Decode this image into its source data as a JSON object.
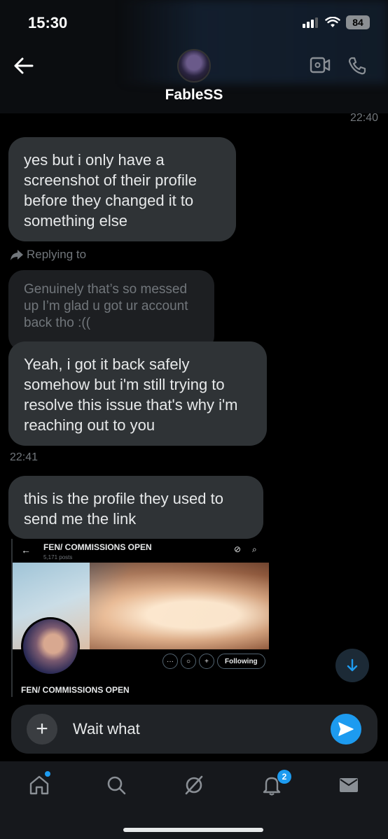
{
  "status": {
    "time": "15:30",
    "battery": "84"
  },
  "header": {
    "title": "FableSS",
    "last_time": "22:40"
  },
  "messages": [
    {
      "text": "yes but i only have a screenshot of their profile before they changed it to something else"
    },
    {
      "reply_label": "Replying to",
      "quoted": "Genuinely that’s so messed up I’m glad u got ur account back tho :((",
      "text": "Yeah, i got it back safely somehow but i'm still trying to resolve this issue that's why i'm reaching out to you",
      "time": "22:41"
    },
    {
      "text": "this is the profile they used to send me the link"
    }
  ],
  "screenshot": {
    "name": "FEN/ COMMISSIONS OPEN",
    "posts": "5,171 posts",
    "follow_label": "Following",
    "name_below": "FEN/ COMMISSIONS OPEN"
  },
  "composer": {
    "value": "Wait what"
  },
  "nav": {
    "notifications_count": "2"
  },
  "colors": {
    "accent": "#1d9bf0",
    "bubble": "#2f3336",
    "background": "#000000"
  }
}
